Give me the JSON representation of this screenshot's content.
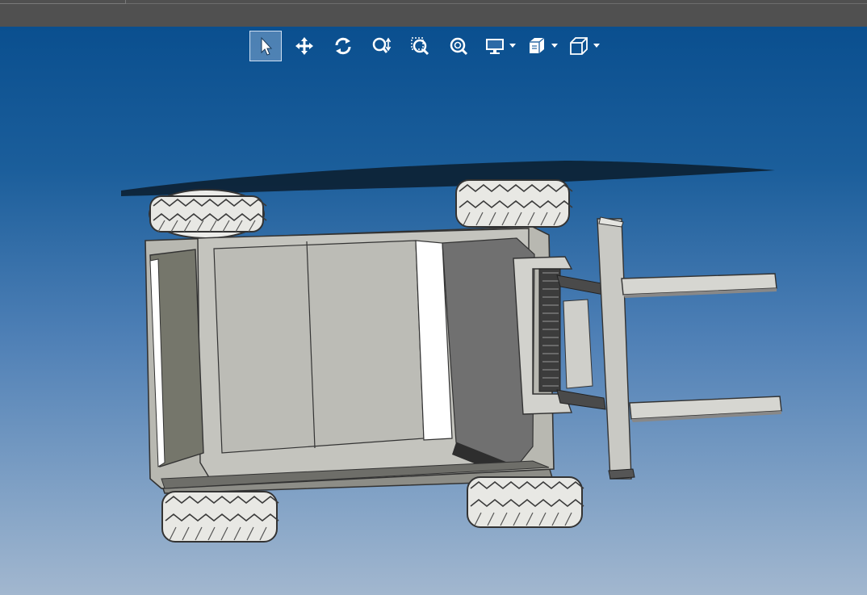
{
  "window": {
    "top_bar": "",
    "viewport_gradient": [
      "#0a4f8f",
      "#a2b7cf"
    ]
  },
  "toolbar": {
    "items": [
      {
        "name": "select",
        "icon": "cursor-arrow-icon",
        "active": true
      },
      {
        "name": "pan",
        "icon": "move-arrows-icon",
        "active": false
      },
      {
        "name": "rotate",
        "icon": "rotate-icon",
        "active": false
      },
      {
        "name": "zoom",
        "icon": "zoom-updown-icon",
        "active": false
      },
      {
        "name": "zoom-window",
        "icon": "zoom-window-icon",
        "active": false
      },
      {
        "name": "zoom-fit",
        "icon": "zoom-fit-icon",
        "active": false
      },
      {
        "name": "display",
        "icon": "monitor-icon",
        "dropdown": true
      },
      {
        "name": "section",
        "icon": "section-cube-icon",
        "dropdown": true
      },
      {
        "name": "view-orientation",
        "icon": "wireframe-cube-icon",
        "dropdown": true
      }
    ]
  },
  "model": {
    "description_hidden": true,
    "body_color": "#b9b9b2",
    "tire_color": "#ececea",
    "shadow_color": "#0b1c2c"
  }
}
